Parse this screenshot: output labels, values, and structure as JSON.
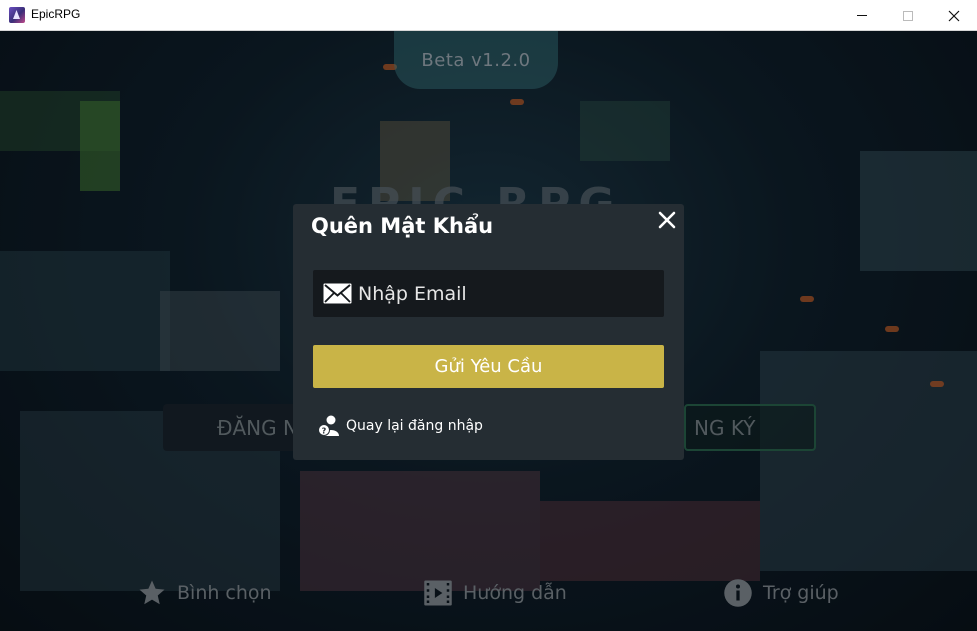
{
  "window": {
    "title": "EpicRPG",
    "icon": "epicrpg-app-icon"
  },
  "game": {
    "version": "Beta v1.2.0",
    "logo": "EPIC RPG",
    "login_label": "ĐĂNG N",
    "register_label": "NG KÝ"
  },
  "bottom_nav": {
    "vote_label": "Bình chọn",
    "guide_label": "Hướng dẫn",
    "help_label": "Trợ giúp"
  },
  "dialog": {
    "title": "Quên Mật Khẩu",
    "email_placeholder": "Nhập Email",
    "email_value": "",
    "submit_label": "Gửi Yêu Cầu",
    "back_label": "Quay lại đăng nhập"
  },
  "colors": {
    "dialog_bg": "#252d33",
    "input_bg": "#15191d",
    "submit_bg": "#c9b447",
    "register_border": "#2c6b52"
  }
}
